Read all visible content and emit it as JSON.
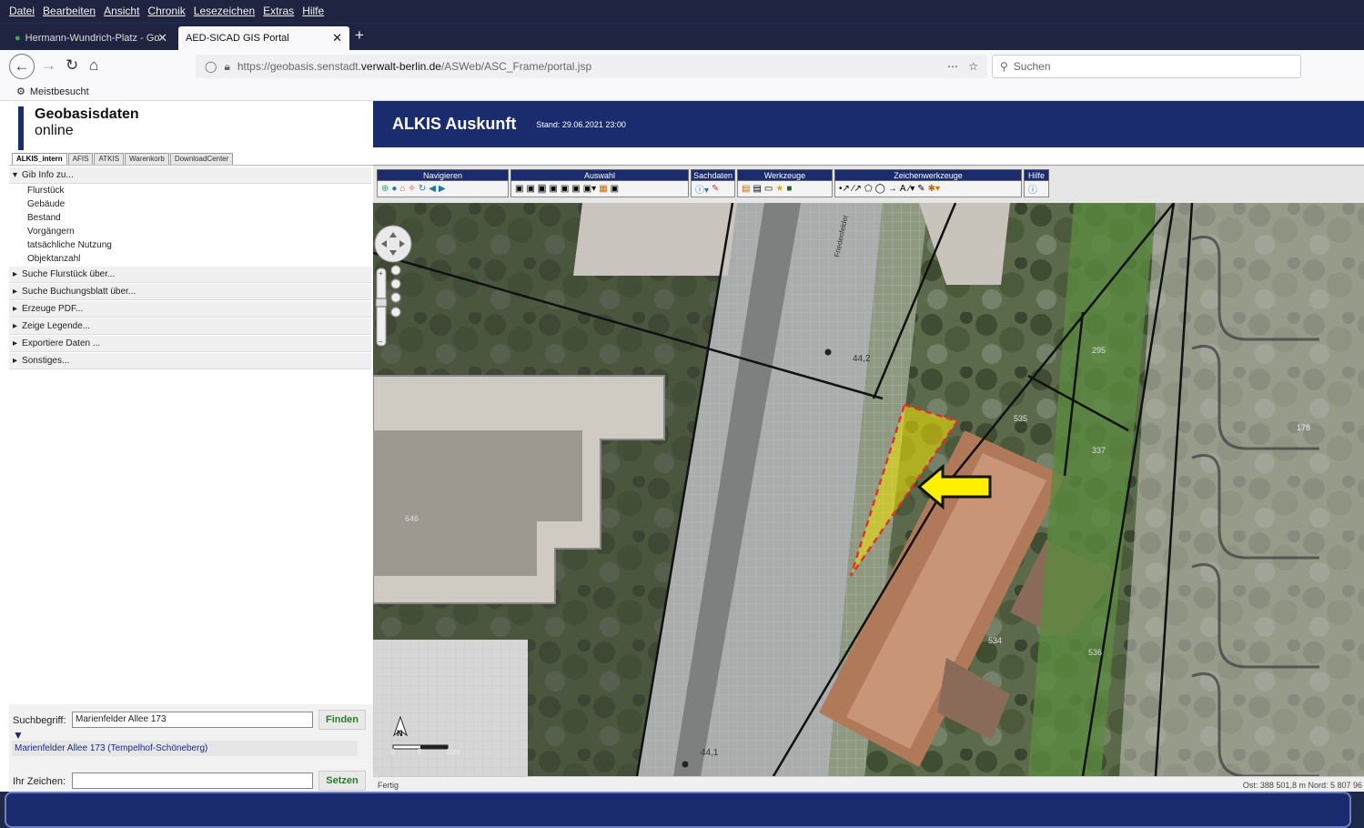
{
  "browser": {
    "menu": [
      "Datei",
      "Bearbeiten",
      "Ansicht",
      "Chronik",
      "Lesezeichen",
      "Extras",
      "Hilfe"
    ],
    "tabs": [
      {
        "title": "Hermann-Wundrich-Platz - Go"
      },
      {
        "title": "AED-SICAD GIS Portal"
      }
    ],
    "new_tab": "+",
    "url_prefix": "https://geobasis.senstadt.",
    "url_domain": "verwalt-berlin.de",
    "url_suffix": "/ASWeb/ASC_Frame/portal.jsp",
    "search_placeholder": "Suchen",
    "bookmark": "Meistbesucht"
  },
  "logo": {
    "line1": "Geobasisdaten",
    "line2": "online"
  },
  "banner": {
    "title": "ALKIS Auskunft",
    "stand": "Stand: 29.06.2021 23:00"
  },
  "portal_tabs": [
    "ALKIS_intern",
    "AFIS",
    "ATKIS",
    "Warenkorb",
    "DownloadCenter"
  ],
  "left": {
    "open_section": "Gib Info zu...",
    "items": [
      "Flurstück",
      "Gebäude",
      "Bestand",
      "Vorgängern",
      "tatsächliche Nutzung",
      "Objektanzahl"
    ],
    "sections": [
      "Suche Flurstück über...",
      "Suche Buchungsblatt über...",
      "Erzeuge PDF...",
      "Zeige Legende...",
      "Exportiere Daten ...",
      "Sonstiges..."
    ],
    "search_label": "Suchbegriff:",
    "search_value": "Marienfelder Allee 173",
    "find_button": "Finden",
    "result": "Marienfelder Allee 173 (Tempelhof-Schöneberg)",
    "sign_label": "Ihr Zeichen:",
    "sign_value": "",
    "set_button": "Setzen"
  },
  "toolbar": {
    "groups": [
      "Navigieren",
      "Auswahl",
      "Sachdaten",
      "Werkzeuge",
      "Zeichenwerkzeuge",
      "Hilfe"
    ]
  },
  "map": {
    "street": "Friedenfelder",
    "labels": [
      "44,2",
      "646",
      "535",
      "337",
      "295",
      "178",
      "534",
      "536",
      "44,1"
    ],
    "scale": [
      "0",
      "5",
      "10m"
    ],
    "north": "N",
    "highlight_color": "#f5e600",
    "arrow_color": "#ffef00",
    "boundary_color": "#e03030"
  },
  "status": {
    "left": "Fertig",
    "right": "Ost: 388 501,8 m  Nord: 5 807 96"
  }
}
